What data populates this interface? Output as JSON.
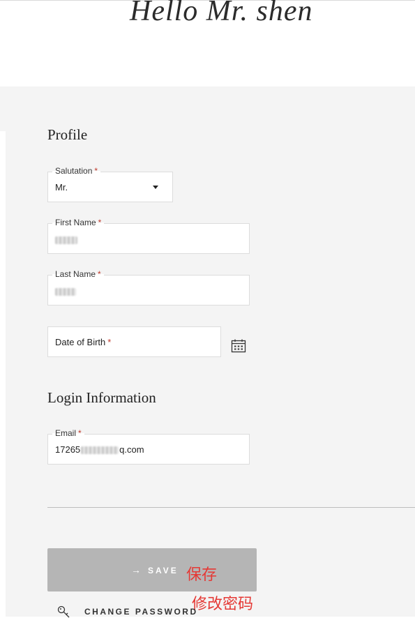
{
  "header": {
    "greeting": "Hello Mr. shen"
  },
  "profile": {
    "title": "Profile",
    "salutation": {
      "label": "Salutation",
      "required_mark": "*",
      "value": "Mr."
    },
    "first_name": {
      "label": "First Name",
      "required_mark": "*"
    },
    "last_name": {
      "label": "Last Name",
      "required_mark": "*"
    },
    "date_of_birth": {
      "placeholder": "Date of Birth",
      "required_mark": "*"
    }
  },
  "login": {
    "title": "Login Information",
    "email": {
      "label": "Email",
      "required_mark": "*",
      "value_prefix": "17265",
      "value_suffix": "q.com"
    }
  },
  "actions": {
    "save_label": "SAVE",
    "save_arrow": "→",
    "change_password_label": "CHANGE PASSWORD"
  },
  "annotations": {
    "save": "保存",
    "change_password": "修改密码"
  },
  "colors": {
    "panel_bg": "#f4f4f4",
    "save_button_bg": "#b5b5b5",
    "required_mark": "#c0392b",
    "annotation": "#e53935"
  }
}
